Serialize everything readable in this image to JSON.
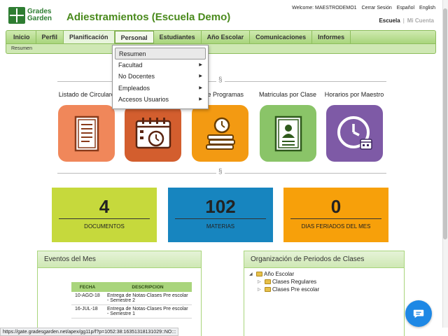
{
  "brand": {
    "line1": "Grades",
    "line2": "Garden"
  },
  "school_title": "Adiestramientos (Escuela Demo)",
  "top_links": [
    "Welcome: MAESTRODEMO1",
    "Cerrar Sesión",
    "Español",
    "English"
  ],
  "sub_links": {
    "escuela": "Escuela",
    "separator": "|",
    "mi_cuenta": "Mi Cuenta"
  },
  "nav": [
    "Inicio",
    "Perfil",
    "Planificación",
    "Personal",
    "Estudiantes",
    "Año Escolar",
    "Comunicaciones",
    "Informes"
  ],
  "sub_bar": "Resumen",
  "dropdown": [
    {
      "label": "Resumen",
      "arrow": ""
    },
    {
      "label": "Facultad",
      "arrow": "▶"
    },
    {
      "label": "No Docentes",
      "arrow": "▶"
    },
    {
      "label": "Empleados",
      "arrow": "▶"
    },
    {
      "label": "Accesos Usuarios",
      "arrow": "▶"
    }
  ],
  "separator_glyph": "§",
  "tiles": [
    {
      "label": "Listado de Circulares",
      "icon": "document-list-icon",
      "color": "#f0875a"
    },
    {
      "label": "",
      "icon": "calendar-clock-icon",
      "color": "#d35e2e"
    },
    {
      "label": "o de Programas",
      "icon": "books-clock-icon",
      "color": "#f39a12"
    },
    {
      "label": "Matriculas por Clase",
      "icon": "id-badge-icon",
      "color": "#8ac468"
    },
    {
      "label": "Horarios por Maestro",
      "icon": "clock-calendar-icon",
      "color": "#7e5aa6"
    }
  ],
  "stats": [
    {
      "value": "4",
      "label": "DOCUMENTOS",
      "color": "#c6d93c"
    },
    {
      "value": "102",
      "label": "MATERIAS",
      "color": "#1785bf"
    },
    {
      "value": "0",
      "label": "DIAS FERIADOS DEL MES",
      "color": "#f7a00a"
    }
  ],
  "events": {
    "title": "Eventos del Mes",
    "headers": [
      "FECHA",
      "DESCRIPCION"
    ],
    "rows": [
      {
        "date": "10-AGO-18",
        "desc": "Entrega de Notas-Clases Pre escolar - Semestre 2"
      },
      {
        "date": "16-JUL-18",
        "desc": "Entrega de Notas-Clases Pre escolar - Semestre 1"
      }
    ]
  },
  "periods": {
    "title": "Organización de Periodos de Clases",
    "tree": [
      "Año Escolar",
      "Clases Regulares",
      "Clases Pre escolar"
    ]
  },
  "status_url": "https://gate.gradesgarden.net/apex/gg11p/f?p=1052:38:16351318131029::NO:::",
  "chat_icon": "chat-bubble-icon"
}
